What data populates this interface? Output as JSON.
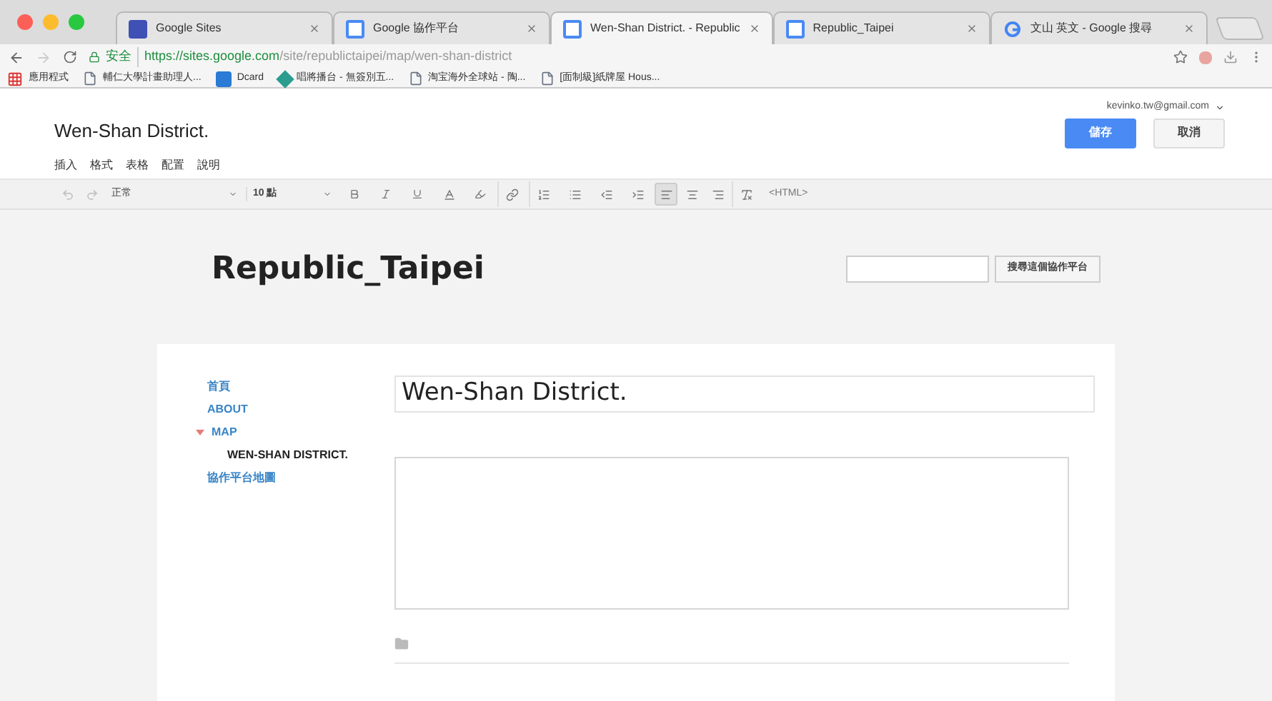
{
  "browser": {
    "tabs": [
      {
        "title": "Google Sites",
        "kind": "sites",
        "selected": false
      },
      {
        "title": "Google 協作平台",
        "kind": "page",
        "selected": false
      },
      {
        "title": "Wen-Shan District. - Republic",
        "kind": "page",
        "selected": true
      },
      {
        "title": "Republic_Taipei",
        "kind": "page",
        "selected": false
      },
      {
        "title": "文山 英文 - Google 搜尋",
        "kind": "google",
        "selected": false
      }
    ],
    "secure_label": "安全",
    "url_host": "https://sites.google.com",
    "url_path": "/site/republictaipei/map/wen-shan-district",
    "bookmarks": [
      {
        "label": "應用程式",
        "kind": "apps"
      },
      {
        "label": "輔仁大學計畫助理人...",
        "kind": "page"
      },
      {
        "label": "Dcard",
        "kind": "dcard"
      },
      {
        "label": "唱將播台 - 無簽別五...",
        "kind": "diamond"
      },
      {
        "label": "淘宝海外全球站 - 陶...",
        "kind": "page"
      },
      {
        "label": "[面制級]紙牌屋 Hous...",
        "kind": "page"
      }
    ]
  },
  "editor": {
    "page_title": "Wen-Shan District.",
    "account": "kevinko.tw@gmail.com",
    "save": "儲存",
    "cancel": "取消",
    "menu": [
      "插入",
      "格式",
      "表格",
      "配置",
      "說明"
    ],
    "style_select": "正常",
    "size_select": "10 點",
    "html_button": "<HTML>",
    "align": [
      {
        "kind": "left",
        "selected": true
      },
      {
        "kind": "center",
        "selected": false
      },
      {
        "kind": "right",
        "selected": false
      }
    ]
  },
  "site": {
    "name": "Republic_Taipei",
    "search_button": "搜尋這個協作平台",
    "nav": [
      {
        "label": "首頁",
        "selected": false
      },
      {
        "label": "ABOUT",
        "selected": false
      },
      {
        "label": "MAP",
        "selected": false,
        "expanded": true,
        "children": [
          {
            "label": "WEN-SHAN DISTRICT.",
            "selected": true
          }
        ]
      },
      {
        "label": "協作平台地圖",
        "selected": false
      }
    ],
    "title_field": "Wen-Shan District."
  }
}
